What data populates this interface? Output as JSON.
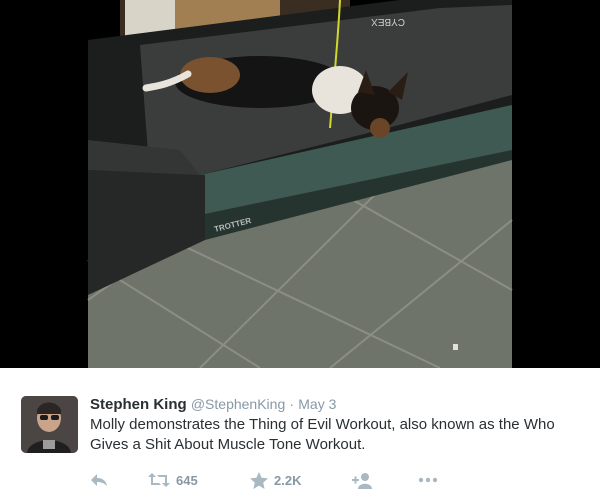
{
  "media": {
    "treadmill_brand": "CYBEX",
    "treadmill_model": "TROTTER"
  },
  "tweet": {
    "author_name": "Stephen King",
    "author_handle": "@StephenKing",
    "separator": "·",
    "date": "May 3",
    "text": "Molly demonstrates the Thing of Evil Workout, also known as the Who Gives a Shit About Muscle Tone Workout.",
    "retweet_count": "645",
    "favorite_count": "2.2K"
  },
  "colors": {
    "name": "#292f33",
    "muted": "#8899a6",
    "action_icon": "#aab8c2"
  },
  "icons": [
    "reply-icon",
    "retweet-icon",
    "favorite-icon",
    "follow-icon",
    "more-icon"
  ]
}
